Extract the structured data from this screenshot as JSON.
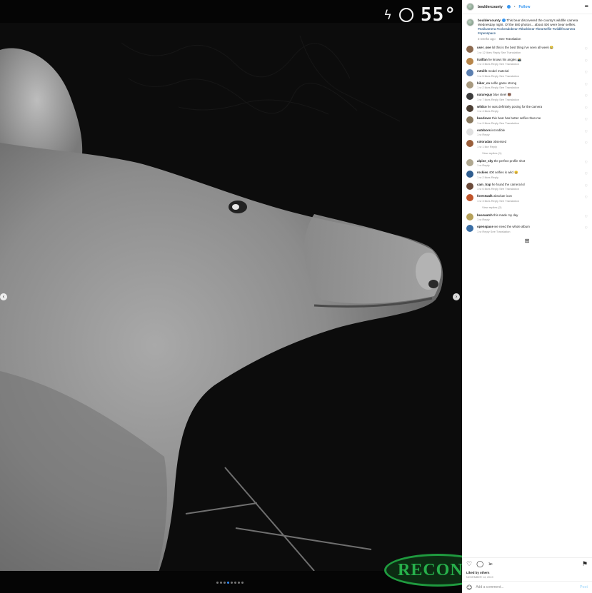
{
  "post": {
    "username": "bouldercounty",
    "follow_label": "Follow",
    "more_icon": "more-dots-icon"
  },
  "photo": {
    "flash_icon": "flash-icon",
    "temperature": "55°",
    "brand": "RECON",
    "prev_icon": "chevron-left-icon",
    "next_icon": "chevron-right-icon"
  },
  "caption": {
    "username": "bouldercounty",
    "text": "This bear discovered the county's wildlife camera Wednesday night. Of the 580 photos... about 400 were bear selfies.",
    "hashtags": "#trailcamera #coloradobear #blackbear #bearselfie #wildlifecamera #openspace",
    "time": "3 weeks ago",
    "see_translation": "See Translation"
  },
  "comments": [
    {
      "name": "comment-1",
      "color": "#8c6a4f",
      "user": "user_one",
      "text": "lol this is the best thing i've seen all week 😂",
      "meta": "1 w   12 likes   Reply   See Translation",
      "replies": ""
    },
    {
      "name": "comment-2",
      "color": "#b8864a",
      "user": "trailfan",
      "text": "he knows his angles 📸",
      "meta": "1 w   3 likes   Reply   See Translation",
      "replies": ""
    },
    {
      "name": "comment-3",
      "color": "#5b7fb0",
      "user": "mtnlife",
      "text": "model material",
      "meta": "1 w   5 likes   Reply   See Translation",
      "replies": ""
    },
    {
      "name": "comment-4",
      "color": "#a89a80",
      "user": "hiker_co",
      "text": "selfie game strong",
      "meta": "1 w   2 likes   Reply   See Translation",
      "replies": ""
    },
    {
      "name": "comment-5",
      "color": "#3c3c3c",
      "user": "natureguy",
      "text": "blue steel 🐻",
      "meta": "1 w   7 likes   Reply   See Translation",
      "replies": ""
    },
    {
      "name": "comment-6",
      "color": "#4d4035",
      "user": "wildco",
      "text": "he was definitely posing for the camera",
      "meta": "1 w   4 likes   Reply",
      "replies": ""
    },
    {
      "name": "comment-7",
      "color": "#8a7a60",
      "user": "bearlover",
      "text": "this bear has better selfies than me",
      "meta": "1 w   9 likes   Reply   See Translation",
      "replies": ""
    },
    {
      "name": "comment-8",
      "color": "#e0e0e0",
      "user": "outdoors",
      "text": "incredible",
      "meta": "1 w   Reply",
      "replies": ""
    },
    {
      "name": "comment-9",
      "color": "#9a5e3a",
      "user": "coloradan",
      "text": "obsessed",
      "meta": "1 w   1 like   Reply",
      "replies": "View replies (1)"
    },
    {
      "name": "comment-10",
      "color": "#b0a890",
      "user": "alpine_sky",
      "text": "the perfect profile shot",
      "meta": "1 w   Reply",
      "replies": ""
    },
    {
      "name": "comment-11",
      "color": "#2f5d8f",
      "user": "rockies",
      "text": "400 selfies is wild 😄",
      "meta": "1 w   2 likes   Reply",
      "replies": ""
    },
    {
      "name": "comment-12",
      "color": "#6b4a3a",
      "user": "cam_trap",
      "text": "he found the camera lol",
      "meta": "1 w   6 likes   Reply   See Translation",
      "replies": ""
    },
    {
      "name": "comment-13",
      "color": "#c0542a",
      "user": "forestwalk",
      "text": "absolute icon",
      "meta": "1 w   3 likes   Reply   See Translation",
      "replies": "View replies (2)"
    },
    {
      "name": "comment-14",
      "color": "#b6a15a",
      "user": "bearwatch",
      "text": "this made my day",
      "meta": "1 w   Reply",
      "replies": ""
    },
    {
      "name": "comment-15",
      "color": "#3a6ea5",
      "user": "openspace",
      "text": "we need the whole album",
      "meta": "1 w   Reply   See Translation",
      "replies": ""
    }
  ],
  "load_more_icon": "load-more-icon",
  "actions": {
    "like_icon": "heart-icon",
    "comment_icon": "comment-bubble-icon",
    "share_icon": "share-plane-icon",
    "save_icon": "bookmark-icon",
    "likes": "Liked by others",
    "date": "November 14, 2019"
  },
  "add_comment": {
    "placeholder": "Add a comment...",
    "post_label": "Post",
    "emoji_icon": "emoji-icon"
  }
}
